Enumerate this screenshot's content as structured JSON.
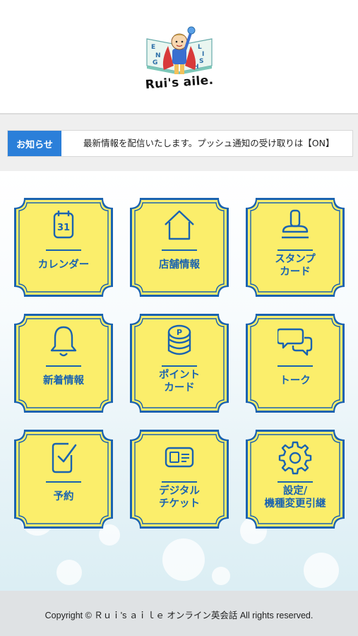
{
  "brand": {
    "logo_text": "Rui's aile.",
    "logo_letters": [
      "E",
      "N",
      "G",
      "L",
      "I",
      "S",
      "H"
    ]
  },
  "news": {
    "label": "お知らせ",
    "message": "最新情報を配信いたします。プッシュ通知の受け取りは【ON】"
  },
  "menu": [
    {
      "label": "カレンダー",
      "icon": "calendar-icon",
      "calendar_day": "31"
    },
    {
      "label": "店舗情報",
      "icon": "home-icon"
    },
    {
      "label": "スタンプ\nカード",
      "icon": "stamp-icon"
    },
    {
      "label": "新着情報",
      "icon": "bell-icon"
    },
    {
      "label": "ポイント\nカード",
      "icon": "points-coins-icon",
      "coin_letter": "P"
    },
    {
      "label": "トーク",
      "icon": "chat-bubbles-icon"
    },
    {
      "label": "予約",
      "icon": "reservation-check-icon"
    },
    {
      "label": "デジタル\nチケット",
      "icon": "ticket-icon"
    },
    {
      "label": "設定/\n機種変更引継",
      "icon": "gear-icon"
    }
  ],
  "footer": {
    "copyright": "Copyright © Ｒｕｉ's ａｉｌｅ オンライン英会話 All rights reserved."
  },
  "colors": {
    "accent": "#2b7fd9",
    "tile_fill": "#fbee6b",
    "tile_border": "#1a63b0"
  }
}
